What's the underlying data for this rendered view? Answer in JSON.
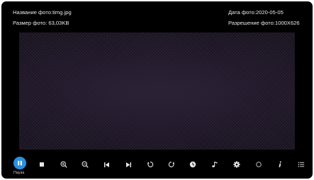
{
  "photo_info": {
    "name": "Название фото:timg.jpg",
    "size": "Размер фото: 63,03KB",
    "date": "Дата фото:2020-05-05",
    "resolution": "Разрешение фото:1000X626"
  },
  "controls": {
    "active_label": "Пауза",
    "accent_color": "#2b8fe0",
    "icons": [
      "pause-icon",
      "stop-icon",
      "zoom-in-icon",
      "zoom-out-icon",
      "previous-icon",
      "next-icon",
      "rotate-left-icon",
      "rotate-right-icon",
      "clock-icon",
      "music-icon",
      "gear-icon",
      "circle-icon",
      "info-icon",
      "list-icon"
    ]
  }
}
